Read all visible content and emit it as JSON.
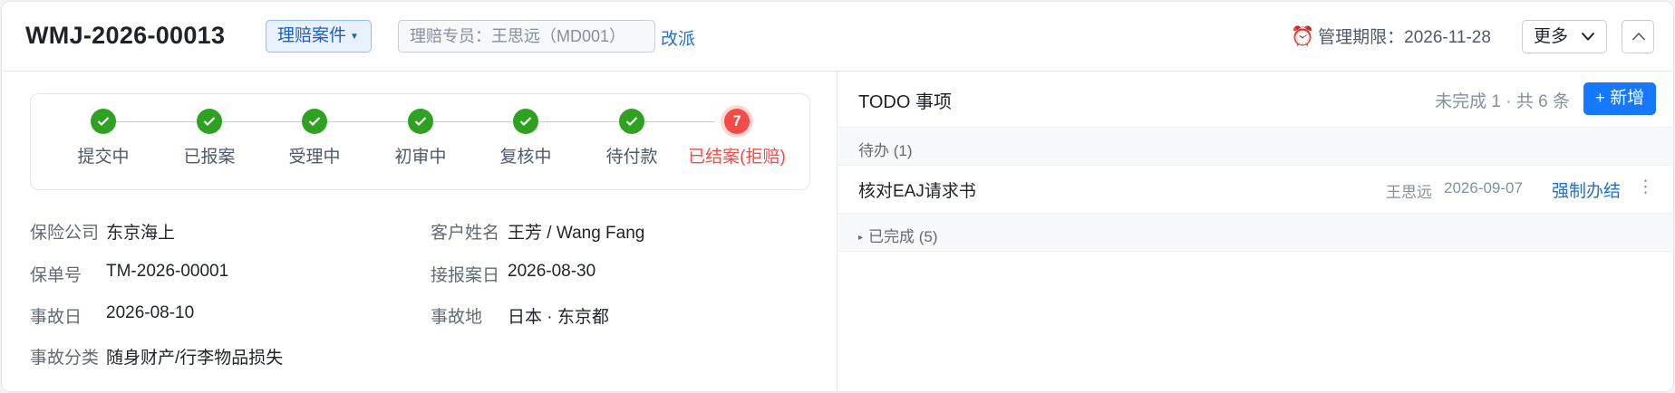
{
  "header": {
    "case_id": "WMJ-2026-00013",
    "case_type": "理赔案件",
    "assignee_placeholder": "理赔专员：王思远（MD001）",
    "reassign": "改派",
    "deadline": "管理期限：2026-11-28",
    "more": "更多"
  },
  "steps": [
    {
      "label": "提交中",
      "status": "done"
    },
    {
      "label": "已报案",
      "status": "done"
    },
    {
      "label": "受理中",
      "status": "done"
    },
    {
      "label": "初审中",
      "status": "done"
    },
    {
      "label": "复核中",
      "status": "done"
    },
    {
      "label": "待付款",
      "status": "done"
    },
    {
      "label": "已结案(拒赔)",
      "status": "current",
      "number": "7"
    }
  ],
  "info": {
    "insurer_label": "保险公司",
    "insurer": "东京海上",
    "customer_label": "客户姓名",
    "customer": "王芳 / Wang Fang",
    "policy_label": "保单号",
    "policy": "TM-2026-00001",
    "report_date_label": "接报案日",
    "report_date": "2026-08-30",
    "accident_date_label": "事故日",
    "accident_date": "2026-08-10",
    "accident_place_label": "事故地",
    "accident_place": "日本 · 东京都",
    "category_label": "事故分类",
    "category": "随身财产/行李物品损失"
  },
  "todo": {
    "title": "TODO 事项",
    "count": "未完成 1 · 共 6 条",
    "add": "+ 新增",
    "pending_group": "待办 (1)",
    "items": [
      {
        "text": "核对EAJ请求书",
        "owner": "王思远",
        "date": "2026-09-07",
        "action": "强制办结"
      }
    ],
    "done_group": "已完成 (5)"
  },
  "colors": {
    "done": "#2ea121",
    "current": "#f54a45",
    "primary": "#1677ff",
    "link": "#1f6fd6"
  }
}
